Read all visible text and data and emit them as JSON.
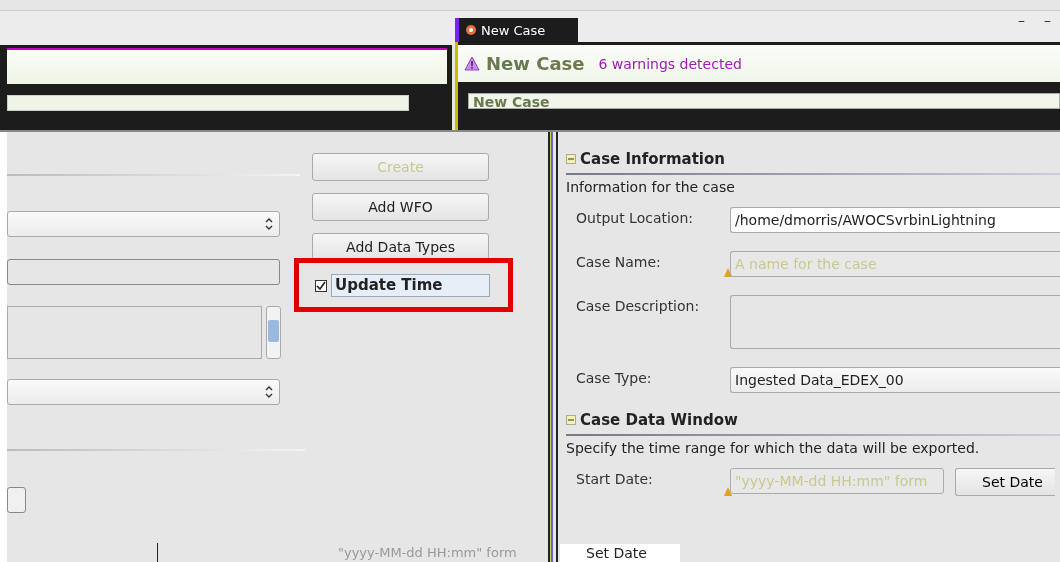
{
  "editor_tab": {
    "label": "New Case",
    "selected": true
  },
  "window_controls": [
    "–",
    "–"
  ],
  "header": {
    "title": "New Case",
    "warning": "6 warnings detected",
    "subtitle": "New Case"
  },
  "actions": [
    {
      "label": "Create",
      "disabled": true
    },
    {
      "label": "Add WFO",
      "disabled": false
    },
    {
      "label": "Add Data Types",
      "disabled": false
    }
  ],
  "update_time": {
    "label": "Update Time",
    "checked": true,
    "highlighted": true
  },
  "sections": [
    {
      "title": "Case Information",
      "expanded": true,
      "description": "Information for the case",
      "fields": [
        {
          "kind": "text",
          "label": "Output Location:",
          "value": "/home/dmorris/AWOCSvrbinLightning",
          "warning": false
        },
        {
          "kind": "text",
          "label": "Case Name:",
          "placeholder": "A name for the case",
          "warning": true
        },
        {
          "kind": "area",
          "label": "Case Description:",
          "warning": false
        },
        {
          "kind": "combo",
          "label": "Case Type:",
          "value": "Ingested Data_EDEX_00",
          "warning": false
        }
      ]
    },
    {
      "title": "Case Data Window",
      "expanded": true,
      "description": "Specify the time range for which the data will be exported.",
      "fields": [
        {
          "kind": "date",
          "label": "Start Date:",
          "placeholder": "\"yyyy-MM-dd HH:mm\" form",
          "button": "Set Date",
          "warning": true
        }
      ]
    }
  ],
  "bottom_strip": {
    "placeholder": "\"yyyy-MM-dd HH:mm\" form",
    "button": "Set Date"
  }
}
